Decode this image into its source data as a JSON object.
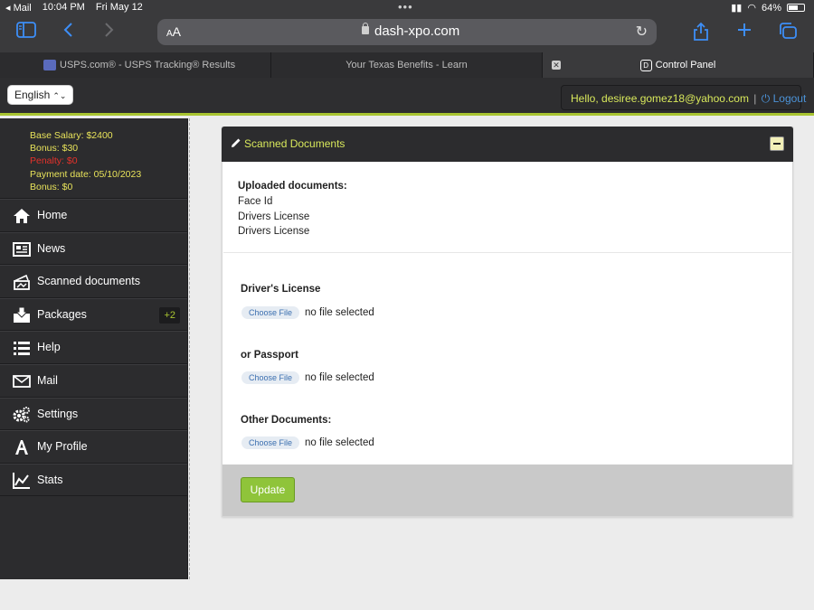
{
  "status_bar": {
    "carrier": "◂ Mail",
    "time": "10:04 PM",
    "date": "Fri May 12",
    "battery_percent": "64%",
    "battery_level": 0.64
  },
  "browser": {
    "aa_label_small": "A",
    "aa_label_large": "A",
    "url": "dash-xpo.com",
    "tabs": [
      {
        "label": "USPS.com® - USPS Tracking® Results"
      },
      {
        "label": "Your Texas Benefits - Learn"
      },
      {
        "label": "Control Panel",
        "favicon_letter": "D"
      }
    ]
  },
  "header": {
    "language": "English",
    "hello": "Hello, desiree.gomez18@yahoo.com",
    "separator": "|",
    "logout": "Logout"
  },
  "sidebar": {
    "stats": {
      "base_salary": "Base Salary: $2400",
      "bonus1": "Bonus: $30",
      "penalty": "Penalty: $0",
      "payment_date": "Payment date: 05/10/2023",
      "bonus2": "Bonus: $0"
    },
    "items": [
      {
        "label": "Home",
        "icon": "home-icon"
      },
      {
        "label": "News",
        "icon": "news-icon"
      },
      {
        "label": "Scanned documents",
        "icon": "scanned-documents-icon"
      },
      {
        "label": "Packages",
        "icon": "packages-icon",
        "badge": "+2"
      },
      {
        "label": "Help",
        "icon": "help-icon"
      },
      {
        "label": "Mail",
        "icon": "mail-icon"
      },
      {
        "label": "Settings",
        "icon": "settings-icon"
      },
      {
        "label": "My Profile",
        "icon": "my-profile-icon"
      },
      {
        "label": "Stats",
        "icon": "stats-icon"
      }
    ]
  },
  "panel": {
    "title": "Scanned Documents",
    "uploaded_heading": "Uploaded documents:",
    "uploaded": [
      "Face Id",
      "Drivers License",
      "Drivers License"
    ],
    "fields": [
      {
        "label": "Driver's License",
        "button": "Choose File",
        "status": "no file selected"
      },
      {
        "label": "or Passport",
        "button": "Choose File",
        "status": "no file selected"
      },
      {
        "label": "Other Documents:",
        "button": "Choose File",
        "status": "no file selected"
      }
    ],
    "update_label": "Update"
  },
  "colors": {
    "accent_green": "#a9c531",
    "sidebar_bg": "#2c2c2e",
    "stat_yellow": "#e8e35a",
    "penalty_red": "#e4322b",
    "link_blue": "#4c93d8",
    "update_green": "#8fc43a"
  }
}
